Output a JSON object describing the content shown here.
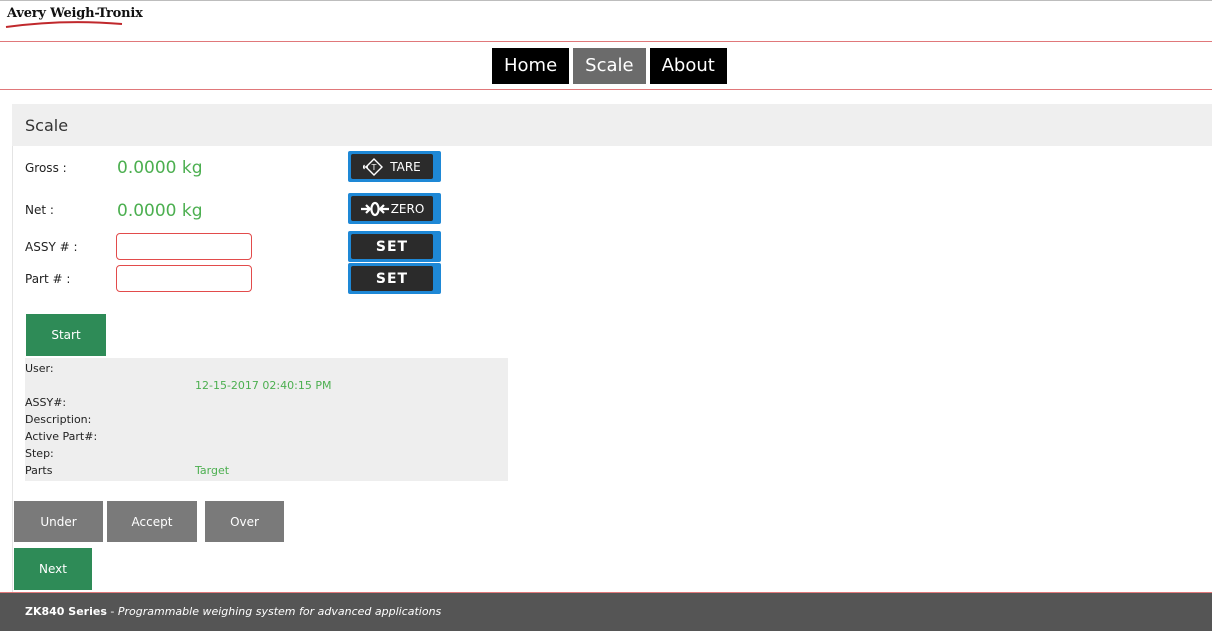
{
  "brand": {
    "name": "Avery Weigh-Tronix",
    "swoosh_color": "#c0282c"
  },
  "nav": {
    "items": [
      "Home",
      "Scale",
      "About"
    ],
    "active": "Scale"
  },
  "panel": {
    "title": "Scale"
  },
  "readings": {
    "gross_label": "Gross :",
    "gross_value": "0.0000 kg",
    "net_label": "Net :",
    "net_value": "0.0000 kg"
  },
  "form": {
    "assy_label": "ASSY # :",
    "assy_value": "",
    "part_label": "Part # :",
    "part_value": ""
  },
  "buttons": {
    "tare": "TARE",
    "zero": "ZERO",
    "set_assy": "SET",
    "set_part": "SET",
    "start": "Start",
    "under": "Under",
    "accept": "Accept",
    "over": "Over",
    "next": "Next"
  },
  "info": {
    "user_label": "User:",
    "timestamp": "12-15-2017 02:40:15 PM",
    "assy_label": "ASSY#:",
    "description_label": "Description:",
    "active_part_label": "Active Part#:",
    "step_label": "Step:",
    "parts_label": "Parts",
    "target_label": "Target"
  },
  "footer": {
    "series": "ZK840 Series",
    "separator": " - ",
    "tagline": "Programmable weighing system for advanced applications"
  },
  "colors": {
    "accent_green": "#4caf50",
    "button_green": "#2e8b57",
    "button_grey": "#7a7a7a",
    "field_border": "#e24b4b",
    "icon_button_blue": "#1e88d6",
    "footer_bg": "#555555"
  }
}
